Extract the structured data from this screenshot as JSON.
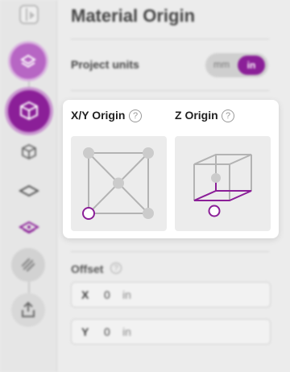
{
  "header": {
    "title": "Material Origin"
  },
  "project_units": {
    "label": "Project units",
    "options": [
      "mm",
      "in"
    ],
    "selected": "in"
  },
  "origin_popover": {
    "xy_title": "X/Y Origin",
    "z_title": "Z Origin",
    "help_glyph": "?",
    "xy_selected_corner": "bottom-left",
    "z_selected": "bottom"
  },
  "offset": {
    "label": "Offset",
    "help_glyph": "?",
    "x": {
      "axis": "X",
      "value": "0",
      "unit": "in"
    },
    "y": {
      "axis": "Y",
      "value": "0",
      "unit": "in"
    }
  },
  "sidebar": {
    "icons": [
      "sidebar-toggle-icon",
      "layers-icon",
      "cube-icon",
      "cube-icon",
      "flat-layer-icon",
      "zero-layer-icon",
      "toolpath-icon",
      "export-icon"
    ]
  },
  "colors": {
    "accent": "#8b1f98",
    "accent_light": "#b766c4",
    "background": "#ececec",
    "tile": "#ececec",
    "line": "#b3b3b3",
    "dot": "#cbcbcb"
  }
}
